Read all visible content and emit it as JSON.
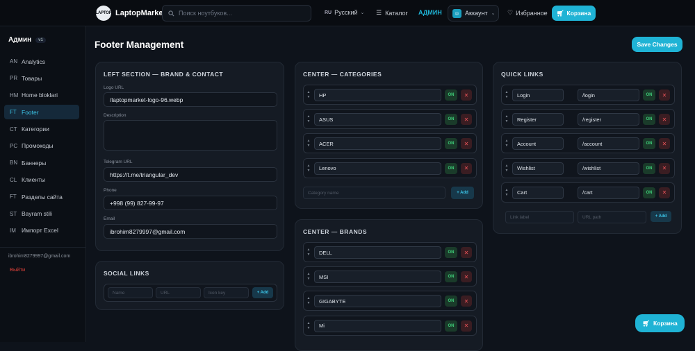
{
  "header": {
    "logo_badge": "LAPTOP",
    "logo_text": "LaptopMarket",
    "search_placeholder": "Поиск ноутбуков...",
    "lang_flag": "RU",
    "lang": "Русский",
    "catalog": "Каталог",
    "admin": "АДМИН",
    "account": "Аккаунт",
    "favorites": "Избранное",
    "cart": "Корзина"
  },
  "sidebar": {
    "title": "Админ",
    "version": "v1",
    "items": [
      {
        "code": "AN",
        "label": "Analytics",
        "active": false
      },
      {
        "code": "PR",
        "label": "Товары",
        "active": false
      },
      {
        "code": "HM",
        "label": "Home bloklari",
        "active": false
      },
      {
        "code": "FT",
        "label": "Footer",
        "active": true
      },
      {
        "code": "CT",
        "label": "Категории",
        "active": false
      },
      {
        "code": "PC",
        "label": "Промокоды",
        "active": false
      },
      {
        "code": "BN",
        "label": "Баннеры",
        "active": false
      },
      {
        "code": "CL",
        "label": "Клиенты",
        "active": false
      },
      {
        "code": "FT",
        "label": "Разделы сайта",
        "active": false
      },
      {
        "code": "ST",
        "label": "Bayram stili",
        "active": false
      },
      {
        "code": "IM",
        "label": "Импорт Excel",
        "active": false
      }
    ],
    "email": "ibrohim8279997@gmail.com",
    "logout": "Выйти"
  },
  "page": {
    "title": "Footer Management",
    "save": "Save Changes"
  },
  "left_section": {
    "title": "LEFT SECTION — BRAND & CONTACT",
    "logo_label": "Logo URL",
    "logo_value": "/laptopmarket-logo-96.webp",
    "desc_label": "Description",
    "desc_value": "",
    "tg_label": "Telegram URL",
    "tg_value": "https://t.me/triangular_dev",
    "phone_label": "Phone",
    "phone_value": "+998 (99) 827-99-97",
    "email_label": "Email",
    "email_value": "ibrohim8279997@gmail.com"
  },
  "social": {
    "title": "SOCIAL LINKS",
    "name_ph": "Name",
    "url_ph": "URL",
    "icon_ph": "Icon key",
    "add": "+ Add"
  },
  "categories": {
    "title": "CENTER — CATEGORIES",
    "items": [
      "HP",
      "ASUS",
      "ACER",
      "Lenovo"
    ],
    "on": "ON",
    "del": "✕",
    "placeholder": "Category name",
    "add": "+ Add"
  },
  "brands": {
    "title": "CENTER — BRANDS",
    "items": [
      "DELL",
      "MSI",
      "GIGABYTE",
      "Mi"
    ],
    "on": "ON",
    "del": "✕"
  },
  "quick_links": {
    "title": "QUICK LINKS",
    "items": [
      {
        "label": "Login",
        "url": "/login"
      },
      {
        "label": "Register",
        "url": "/register"
      },
      {
        "label": "Account",
        "url": "/account"
      },
      {
        "label": "Wishlist",
        "url": "/wishlist"
      },
      {
        "label": "Cart",
        "url": "/cart"
      }
    ],
    "on": "ON",
    "del": "✕",
    "label_ph": "Link label",
    "url_ph": "URL path",
    "add": "+ Add"
  },
  "float_cart": "Корзина",
  "colors": {
    "accent": "#1fb3d5",
    "on": "#3fcf7a",
    "danger": "#e65257",
    "bg": "#0e131b",
    "card": "#151b24"
  }
}
